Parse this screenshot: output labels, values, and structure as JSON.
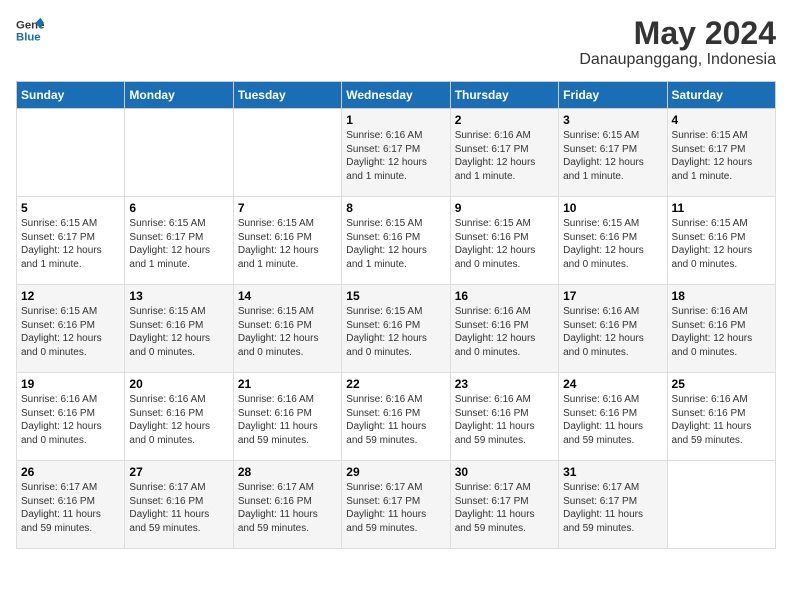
{
  "logo": {
    "line1": "General",
    "line2": "Blue"
  },
  "title": "May 2024",
  "subtitle": "Danaupanggang, Indonesia",
  "weekdays": [
    "Sunday",
    "Monday",
    "Tuesday",
    "Wednesday",
    "Thursday",
    "Friday",
    "Saturday"
  ],
  "weeks": [
    [
      {
        "day": "",
        "info": ""
      },
      {
        "day": "",
        "info": ""
      },
      {
        "day": "",
        "info": ""
      },
      {
        "day": "1",
        "info": "Sunrise: 6:16 AM\nSunset: 6:17 PM\nDaylight: 12 hours\nand 1 minute."
      },
      {
        "day": "2",
        "info": "Sunrise: 6:16 AM\nSunset: 6:17 PM\nDaylight: 12 hours\nand 1 minute."
      },
      {
        "day": "3",
        "info": "Sunrise: 6:15 AM\nSunset: 6:17 PM\nDaylight: 12 hours\nand 1 minute."
      },
      {
        "day": "4",
        "info": "Sunrise: 6:15 AM\nSunset: 6:17 PM\nDaylight: 12 hours\nand 1 minute."
      }
    ],
    [
      {
        "day": "5",
        "info": "Sunrise: 6:15 AM\nSunset: 6:17 PM\nDaylight: 12 hours\nand 1 minute."
      },
      {
        "day": "6",
        "info": "Sunrise: 6:15 AM\nSunset: 6:17 PM\nDaylight: 12 hours\nand 1 minute."
      },
      {
        "day": "7",
        "info": "Sunrise: 6:15 AM\nSunset: 6:16 PM\nDaylight: 12 hours\nand 1 minute."
      },
      {
        "day": "8",
        "info": "Sunrise: 6:15 AM\nSunset: 6:16 PM\nDaylight: 12 hours\nand 1 minute."
      },
      {
        "day": "9",
        "info": "Sunrise: 6:15 AM\nSunset: 6:16 PM\nDaylight: 12 hours\nand 0 minutes."
      },
      {
        "day": "10",
        "info": "Sunrise: 6:15 AM\nSunset: 6:16 PM\nDaylight: 12 hours\nand 0 minutes."
      },
      {
        "day": "11",
        "info": "Sunrise: 6:15 AM\nSunset: 6:16 PM\nDaylight: 12 hours\nand 0 minutes."
      }
    ],
    [
      {
        "day": "12",
        "info": "Sunrise: 6:15 AM\nSunset: 6:16 PM\nDaylight: 12 hours\nand 0 minutes."
      },
      {
        "day": "13",
        "info": "Sunrise: 6:15 AM\nSunset: 6:16 PM\nDaylight: 12 hours\nand 0 minutes."
      },
      {
        "day": "14",
        "info": "Sunrise: 6:15 AM\nSunset: 6:16 PM\nDaylight: 12 hours\nand 0 minutes."
      },
      {
        "day": "15",
        "info": "Sunrise: 6:15 AM\nSunset: 6:16 PM\nDaylight: 12 hours\nand 0 minutes."
      },
      {
        "day": "16",
        "info": "Sunrise: 6:16 AM\nSunset: 6:16 PM\nDaylight: 12 hours\nand 0 minutes."
      },
      {
        "day": "17",
        "info": "Sunrise: 6:16 AM\nSunset: 6:16 PM\nDaylight: 12 hours\nand 0 minutes."
      },
      {
        "day": "18",
        "info": "Sunrise: 6:16 AM\nSunset: 6:16 PM\nDaylight: 12 hours\nand 0 minutes."
      }
    ],
    [
      {
        "day": "19",
        "info": "Sunrise: 6:16 AM\nSunset: 6:16 PM\nDaylight: 12 hours\nand 0 minutes."
      },
      {
        "day": "20",
        "info": "Sunrise: 6:16 AM\nSunset: 6:16 PM\nDaylight: 12 hours\nand 0 minutes."
      },
      {
        "day": "21",
        "info": "Sunrise: 6:16 AM\nSunset: 6:16 PM\nDaylight: 11 hours\nand 59 minutes."
      },
      {
        "day": "22",
        "info": "Sunrise: 6:16 AM\nSunset: 6:16 PM\nDaylight: 11 hours\nand 59 minutes."
      },
      {
        "day": "23",
        "info": "Sunrise: 6:16 AM\nSunset: 6:16 PM\nDaylight: 11 hours\nand 59 minutes."
      },
      {
        "day": "24",
        "info": "Sunrise: 6:16 AM\nSunset: 6:16 PM\nDaylight: 11 hours\nand 59 minutes."
      },
      {
        "day": "25",
        "info": "Sunrise: 6:16 AM\nSunset: 6:16 PM\nDaylight: 11 hours\nand 59 minutes."
      }
    ],
    [
      {
        "day": "26",
        "info": "Sunrise: 6:17 AM\nSunset: 6:16 PM\nDaylight: 11 hours\nand 59 minutes."
      },
      {
        "day": "27",
        "info": "Sunrise: 6:17 AM\nSunset: 6:16 PM\nDaylight: 11 hours\nand 59 minutes."
      },
      {
        "day": "28",
        "info": "Sunrise: 6:17 AM\nSunset: 6:16 PM\nDaylight: 11 hours\nand 59 minutes."
      },
      {
        "day": "29",
        "info": "Sunrise: 6:17 AM\nSunset: 6:17 PM\nDaylight: 11 hours\nand 59 minutes."
      },
      {
        "day": "30",
        "info": "Sunrise: 6:17 AM\nSunset: 6:17 PM\nDaylight: 11 hours\nand 59 minutes."
      },
      {
        "day": "31",
        "info": "Sunrise: 6:17 AM\nSunset: 6:17 PM\nDaylight: 11 hours\nand 59 minutes."
      },
      {
        "day": "",
        "info": ""
      }
    ]
  ]
}
